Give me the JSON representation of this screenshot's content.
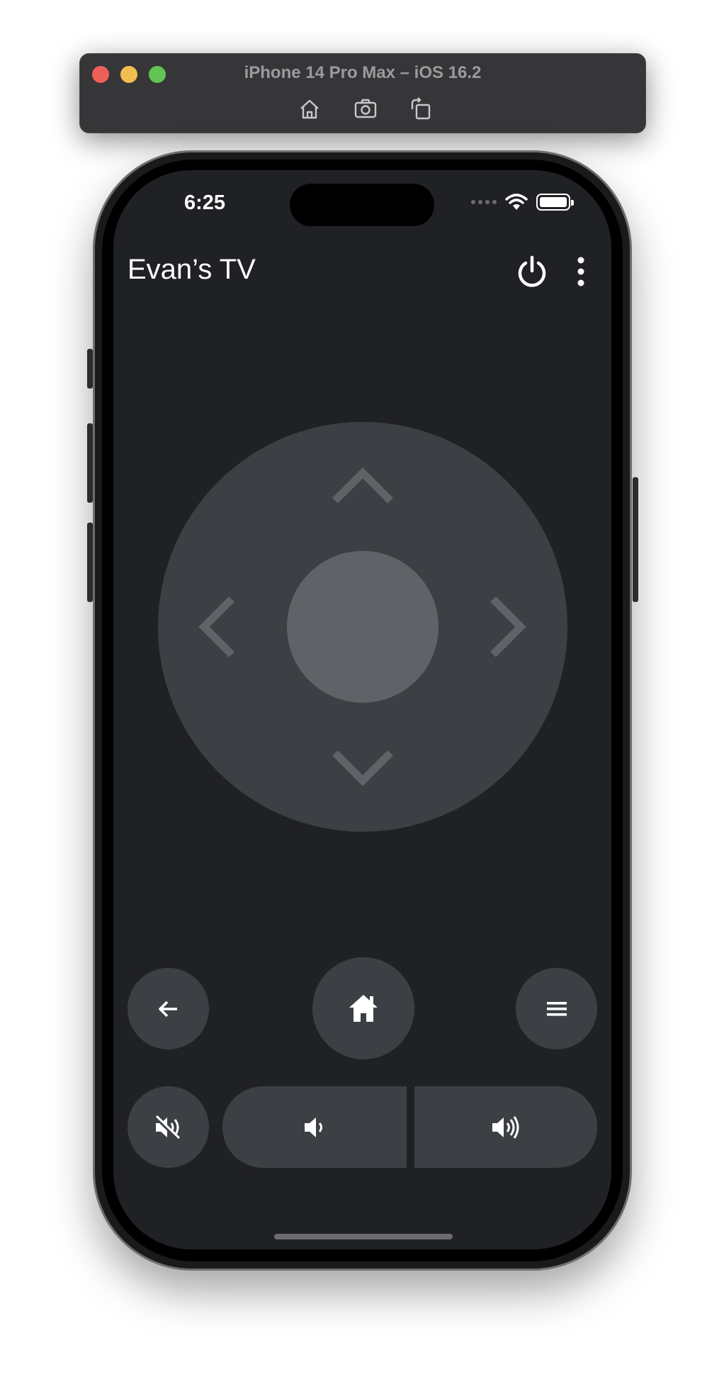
{
  "simulator": {
    "title": "iPhone 14 Pro Max – iOS 16.2",
    "tools": [
      "home-icon",
      "screenshot-icon",
      "rotate-icon"
    ]
  },
  "status_bar": {
    "time": "6:25",
    "icons": [
      "cellular-icon",
      "wifi-icon",
      "battery-icon"
    ]
  },
  "app": {
    "title": "Evan’s TV",
    "actions": [
      "power-icon",
      "more-vert-icon"
    ]
  },
  "dpad": {
    "directions": [
      "up",
      "down",
      "left",
      "right"
    ],
    "center": "select"
  },
  "controls": {
    "row1": [
      "back-arrow-icon",
      "home-icon",
      "menu-icon"
    ],
    "row2": [
      "mute-icon",
      "volume-down-icon",
      "volume-up-icon"
    ]
  },
  "colors": {
    "screen_bg": "#202124",
    "button_bg": "#3c3f43",
    "dpad_center": "#5f6368",
    "arrow": "#5f6368",
    "icon": "#ffffff"
  }
}
